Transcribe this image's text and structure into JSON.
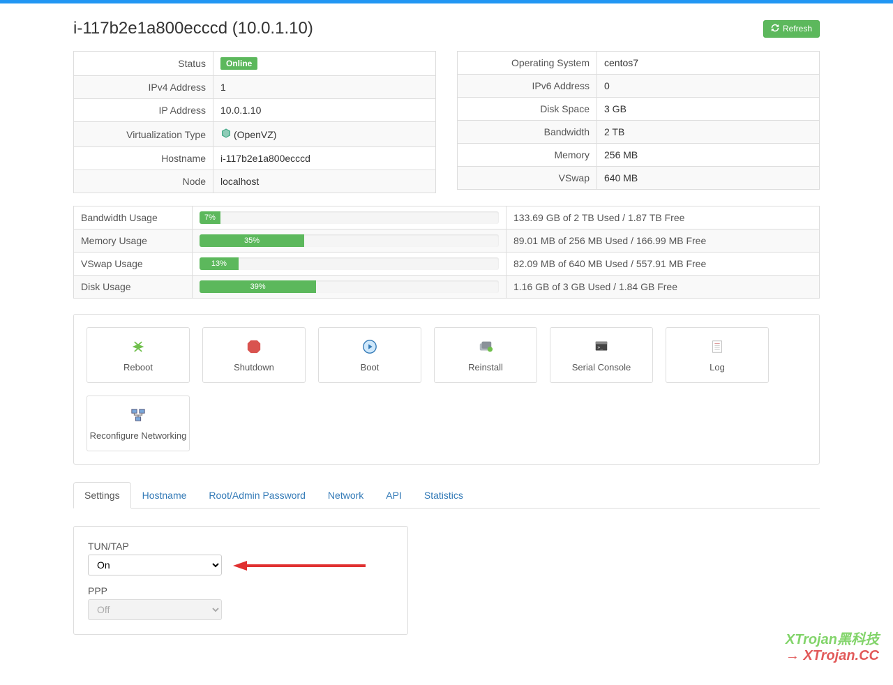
{
  "header": {
    "title": "i-117b2e1a800ecccd (10.0.1.10)",
    "refresh": "Refresh"
  },
  "info_left": {
    "status_label": "Status",
    "status_value": "Online",
    "ipv4_label": "IPv4 Address",
    "ipv4_value": "1",
    "ip_label": "IP Address",
    "ip_value": "10.0.1.10",
    "virt_label": "Virtualization Type",
    "virt_value": "(OpenVZ)",
    "hostname_label": "Hostname",
    "hostname_value": "i-117b2e1a800ecccd",
    "node_label": "Node",
    "node_value": "localhost"
  },
  "info_right": {
    "os_label": "Operating System",
    "os_value": "centos7",
    "ipv6_label": "IPv6 Address",
    "ipv6_value": "0",
    "disk_label": "Disk Space",
    "disk_value": "3 GB",
    "bw_label": "Bandwidth",
    "bw_value": "2 TB",
    "mem_label": "Memory",
    "mem_value": "256 MB",
    "vswap_label": "VSwap",
    "vswap_value": "640 MB"
  },
  "usage": [
    {
      "label": "Bandwidth Usage",
      "percent": 7,
      "pct_text": "7%",
      "text": "133.69 GB of 2 TB Used / 1.87 TB Free"
    },
    {
      "label": "Memory Usage",
      "percent": 35,
      "pct_text": "35%",
      "text": "89.01 MB of 256 MB Used / 166.99 MB Free"
    },
    {
      "label": "VSwap Usage",
      "percent": 13,
      "pct_text": "13%",
      "text": "82.09 MB of 640 MB Used / 557.91 MB Free"
    },
    {
      "label": "Disk Usage",
      "percent": 39,
      "pct_text": "39%",
      "text": "1.16 GB of 3 GB Used / 1.84 GB Free"
    }
  ],
  "actions": {
    "reboot": "Reboot",
    "shutdown": "Shutdown",
    "boot": "Boot",
    "reinstall": "Reinstall",
    "serial": "Serial Console",
    "log": "Log",
    "reconfig": "Reconfigure Networking"
  },
  "tabs": {
    "settings": "Settings",
    "hostname": "Hostname",
    "rootpw": "Root/Admin Password",
    "network": "Network",
    "api": "API",
    "stats": "Statistics"
  },
  "settings": {
    "tuntap_label": "TUN/TAP",
    "tuntap_value": "On",
    "ppp_label": "PPP",
    "ppp_value": "Off"
  },
  "watermark": {
    "line1": "XTrojan黑科技",
    "line2": "→ XTrojan.CC"
  }
}
